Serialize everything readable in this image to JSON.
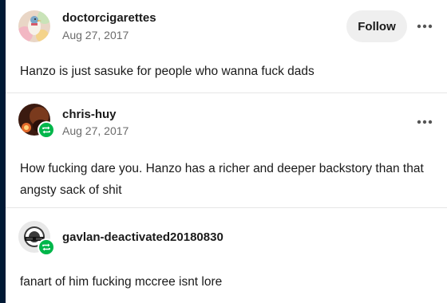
{
  "posts": [
    {
      "username": "doctorcigarettes",
      "date": "Aug 27, 2017",
      "follow_label": "Follow",
      "text": "Hanzo is just sasuke for people who wanna fuck dads",
      "avatar_icon": "duck-illustration-avatar"
    },
    {
      "username": "chris-huy",
      "date": "Aug 27, 2017",
      "text": "How fucking dare you. Hanzo has a richer and deeper backstory than that angsty sack of shit",
      "avatar_icon": "dark-portrait-avatar",
      "reblog_icon": "reblog-icon"
    },
    {
      "username": "gavlan-deactivated20180830",
      "text": "fanart of him fucking mccree isnt lore",
      "avatar_icon": "deactivated-shades-avatar",
      "reblog_icon": "reblog-icon"
    }
  ],
  "colors": {
    "reblog_green": "#00b64a",
    "date_gray": "#6b6b6b",
    "stripe_navy": "#001935",
    "follow_bg": "#efefef"
  }
}
